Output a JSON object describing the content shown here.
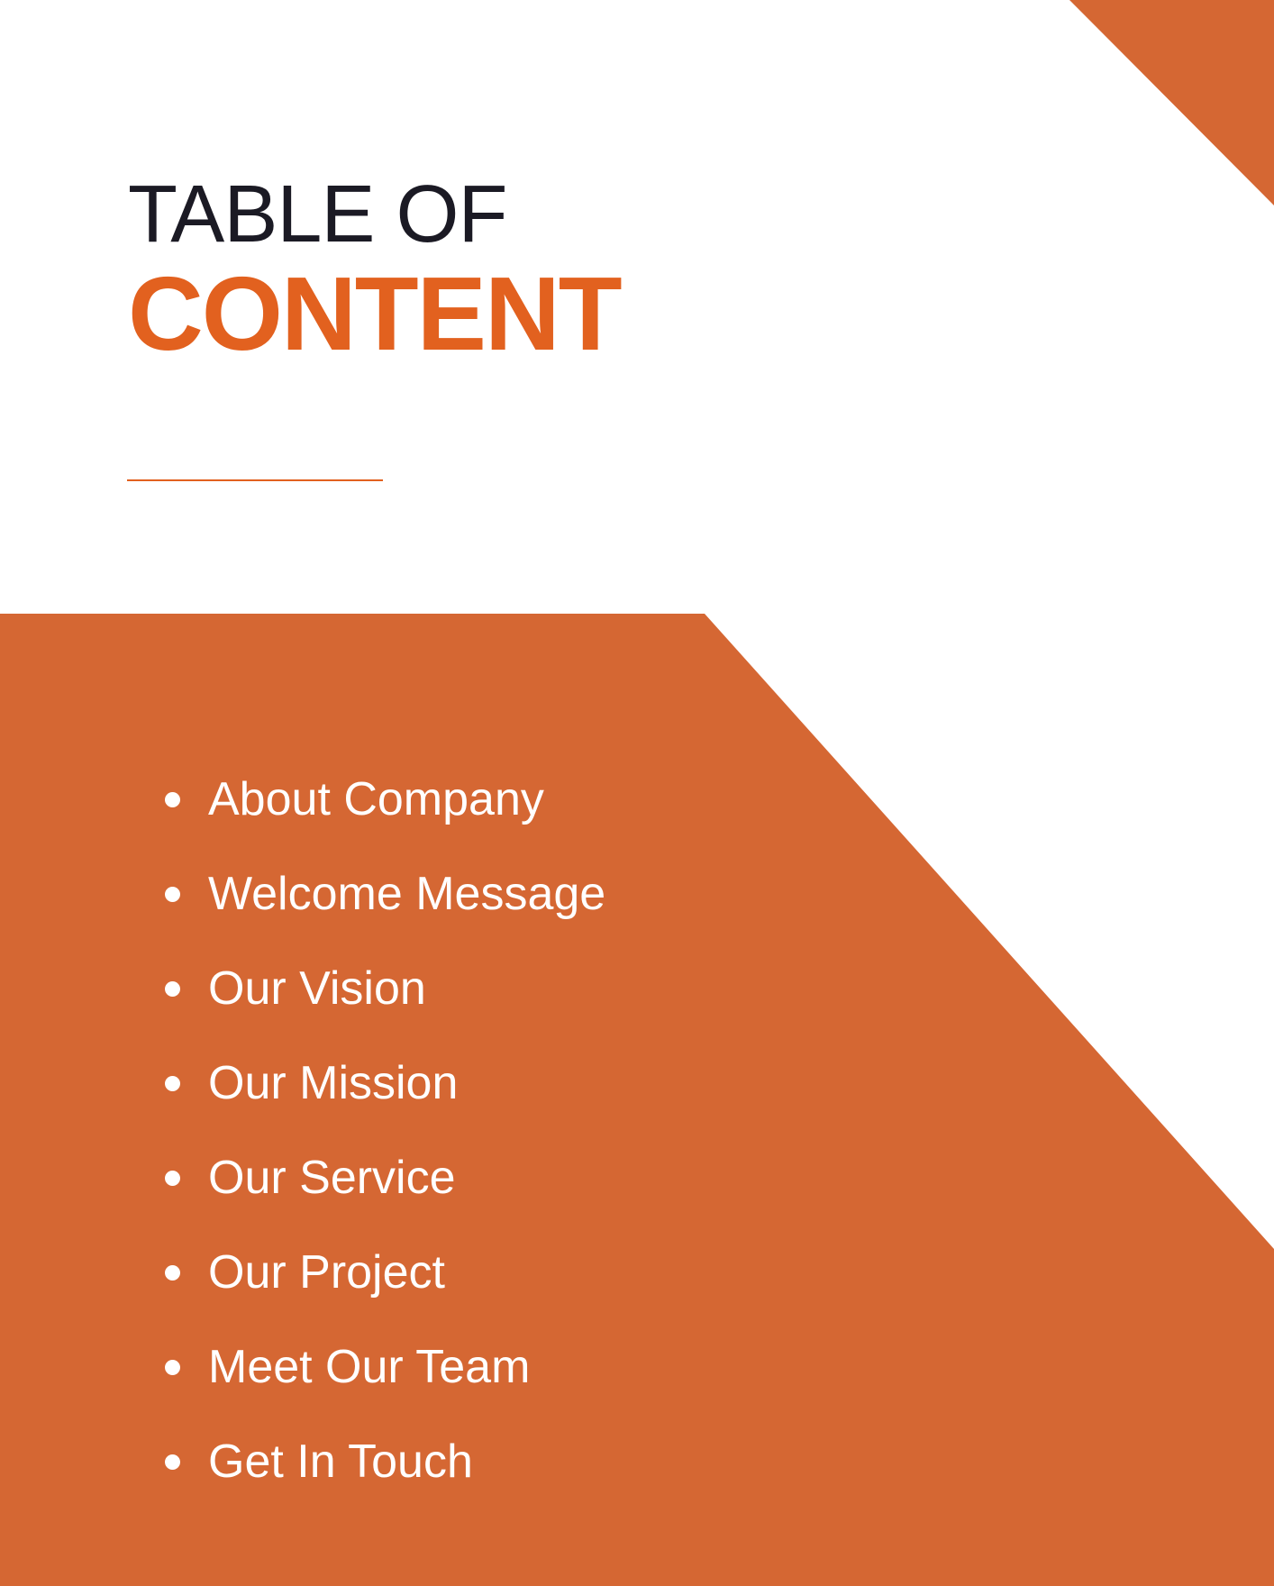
{
  "colors": {
    "accent": "#e2611f",
    "panel": "#d56733",
    "title_text": "#1b1a24",
    "list_text": "#ffffff"
  },
  "title": {
    "line1": "TABLE OF",
    "line2": "CONTENT"
  },
  "toc": {
    "items": [
      {
        "label": "About Company"
      },
      {
        "label": "Welcome Message"
      },
      {
        "label": "Our Vision"
      },
      {
        "label": "Our Mission"
      },
      {
        "label": "Our Service"
      },
      {
        "label": "Our Project"
      },
      {
        "label": "Meet Our Team"
      },
      {
        "label": "Get In Touch"
      }
    ]
  }
}
